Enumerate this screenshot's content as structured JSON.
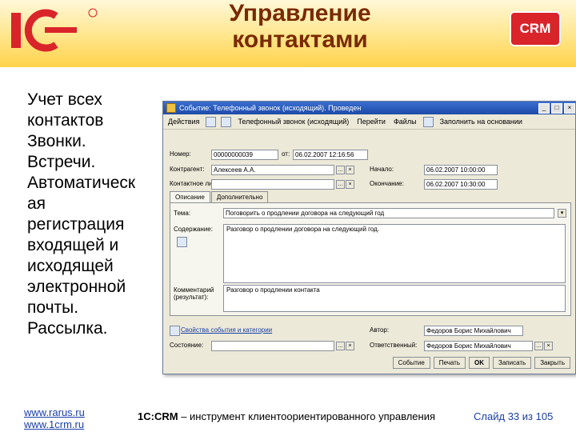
{
  "header": {
    "title_line1": "Управление",
    "title_line2": "контактами",
    "badge": "CRM",
    "logo_text": "1С"
  },
  "bullets": [
    "Учет всех",
    "контактов",
    "Звонки.",
    "Встречи.",
    "Автоматическ",
    "ая",
    "регистрация",
    "входящей и",
    "исходящей",
    "электронной",
    "почты.",
    "Рассылка."
  ],
  "window": {
    "title": "Событие: Телефонный звонок (исходящий). Проведен",
    "toolbar": [
      "Действия",
      "Телефонный звонок (исходящий)",
      "Перейти",
      "Файлы",
      "Заполнить на основании"
    ],
    "labels": {
      "nomer": "Номер:",
      "ot": "от:",
      "kontragent": "Контрагент:",
      "kontaktnoe_lico": "Контактное лицо:",
      "nachalo": "Начало:",
      "okonchanie": "Окончание:",
      "tema": "Тема:",
      "soderzhanie": "Содержание:",
      "kommentariy": "Комментарий (результат):",
      "sostoyanie": "Состояние:",
      "avtor": "Автор:",
      "otvetstvennyy": "Ответственный:"
    },
    "values": {
      "nomer": "00000000039",
      "data": "06.02.2007 12:16:56",
      "kontragent": "Алексеев А.А.",
      "kontaktnoe_lico": "",
      "nachalo": "06.02.2007 10:00:00",
      "okonchanie": "06.02.2007 10:30:00",
      "tema": "Поговорить о продлении договора на следующий год",
      "soderzhanie": "Разговор о продлении договора на следующий год.",
      "kommentariy": "Разговор о продлении контакта",
      "avtor": "Федоров Борис Михайлович",
      "otvetstvennyy": "Федоров Борис Михайлович",
      "sostoyanie": ""
    },
    "tabs": [
      "Описание",
      "Дополнительно"
    ],
    "link": "Свойства события и категории",
    "buttons": {
      "print": "Событие",
      "print2": "Печать",
      "ok": "OK",
      "save": "Записать",
      "close": "Закрыть"
    }
  },
  "footer": {
    "site1": "www.rarus.ru",
    "site2": "www.1crm.ru",
    "title_main": "1С:CRM",
    "title_sub": "– инструмент клиентоориентированного управления",
    "slide_label": "Слайд",
    "slide_num": "33",
    "slide_of": "из",
    "slide_total": "105"
  },
  "colors": {
    "title": "#7a2a00",
    "badge": "#d9242a",
    "link": "#1a3fa8"
  }
}
